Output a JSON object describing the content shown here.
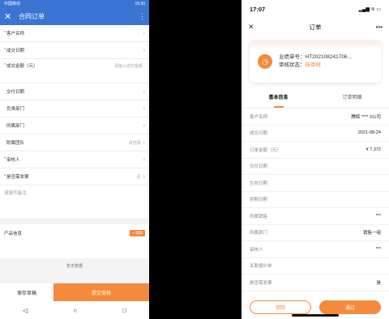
{
  "left": {
    "status": {
      "left": "中国移动",
      "right": "15:30"
    },
    "appbar": {
      "title": "合同订单"
    },
    "fields": [
      {
        "required": true,
        "label": "客户名称",
        "value": ""
      },
      {
        "required": true,
        "label": "成交日期",
        "value": ""
      },
      {
        "required": true,
        "label": "成交金额（元）",
        "value": "请输入成交金额"
      },
      {
        "required": false,
        "label": "交付日期",
        "value": ""
      },
      {
        "required": false,
        "label": "负责部门",
        "value": ""
      },
      {
        "required": false,
        "label": "所属部门",
        "value": ""
      },
      {
        "required": false,
        "label": "附属团队",
        "value": "请选择"
      },
      {
        "required": true,
        "label": "审核人",
        "value": ""
      },
      {
        "required": true,
        "label": "是否需发票",
        "value": "否"
      }
    ],
    "remark_placeholder": "请填写备注",
    "product": {
      "label": "产品信息",
      "add_label": "+ 添加"
    },
    "hint": "暂无数据",
    "buttons": {
      "save": "保存草稿",
      "submit": "提交审核"
    },
    "nav": {
      "back": "◁",
      "home": "○",
      "recent": "□"
    }
  },
  "right": {
    "status": {
      "time": "17:07",
      "signal": "▂▄▆ ≋ ▭"
    },
    "header": {
      "title": "订单"
    },
    "card": {
      "order_label": "业绩单号：",
      "order_no": "HT202108241706...",
      "status_label": "审核状态：",
      "status_value": "待审核"
    },
    "tabs": [
      "基本信息",
      "订单明细"
    ],
    "rows": [
      {
        "label": "客户名称",
        "value": "腾辉 **** 3公司"
      },
      {
        "label": "成交日期",
        "value": "2021-08-24"
      },
      {
        "label": "订单金额（元）",
        "value": "¥ 7,372"
      },
      {
        "label": "交付日期",
        "value": ""
      },
      {
        "label": "生效日期",
        "value": ""
      },
      {
        "label": "到期日期",
        "value": ""
      },
      {
        "label": "所属销售",
        "value": "***"
      },
      {
        "label": "所属部门",
        "value": "销售一组"
      },
      {
        "label": "审核人",
        "value": "***"
      },
      {
        "label": "关联报价单",
        "value": ""
      },
      {
        "label": "是否需发票",
        "value": "是"
      }
    ],
    "buttons": {
      "back": "驳回",
      "pass": "通过"
    }
  },
  "colors": {
    "primary": "#3b74d3",
    "accent": "#f58a3c"
  }
}
